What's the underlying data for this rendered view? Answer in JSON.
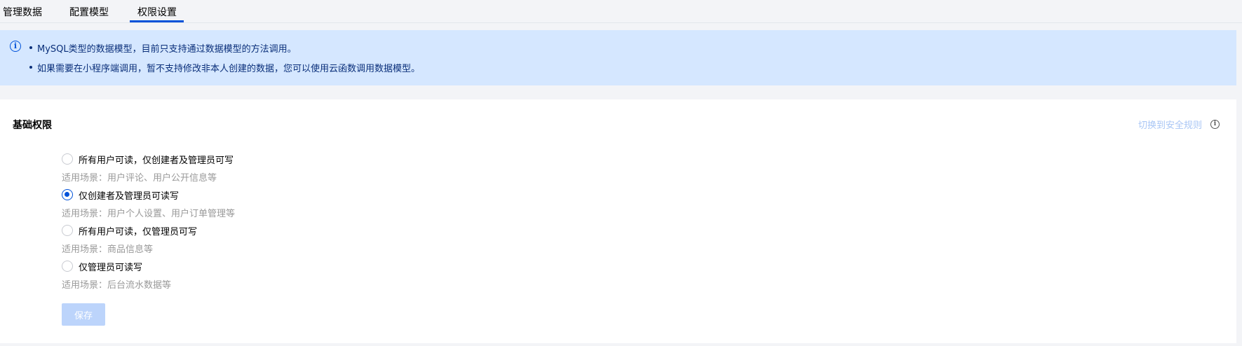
{
  "tabs": [
    {
      "label": "管理数据",
      "active": false
    },
    {
      "label": "配置模型",
      "active": false
    },
    {
      "label": "权限设置",
      "active": true
    }
  ],
  "notice": {
    "icon": "info-icon",
    "lines": [
      "MySQL类型的数据模型，目前只支持通过数据模型的方法调用。",
      "如果需要在小程序端调用，暂不支持修改非本人创建的数据，您可以使用云函数调用数据模型。"
    ]
  },
  "permissions": {
    "title": "基础权限",
    "switch_link": "切换到安全规则",
    "options": [
      {
        "label": "所有用户可读，仅创建者及管理员可写",
        "desc": "适用场景：用户评论、用户公开信息等",
        "checked": false
      },
      {
        "label": "仅创建者及管理员可读写",
        "desc": "适用场景：用户个人设置、用户订单管理等",
        "checked": true
      },
      {
        "label": "所有用户可读，仅管理员可写",
        "desc": "适用场景：商品信息等",
        "checked": false
      },
      {
        "label": "仅管理员可读写",
        "desc": "适用场景：后台流水数据等",
        "checked": false
      }
    ],
    "save_label": "保存"
  },
  "colors": {
    "accent": "#0052d9",
    "notice_bg": "#d5e7ff",
    "disabled_button": "#bcd4fb"
  }
}
